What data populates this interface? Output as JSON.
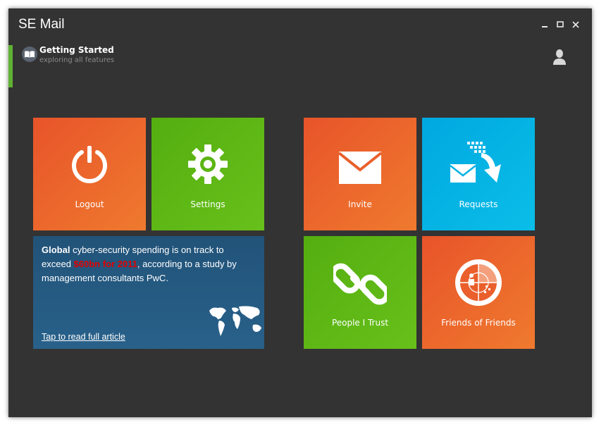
{
  "window": {
    "title": "SE Mail",
    "controls": {
      "minimize": "minimize-icon",
      "maximize": "maximize-icon",
      "close": "close-icon"
    }
  },
  "section": {
    "title": "Getting Started",
    "subtitle": "exploring all features",
    "icon": "book-icon"
  },
  "header": {
    "user_icon": "user-icon"
  },
  "tiles": {
    "logout": {
      "label": "Logout",
      "icon": "power-icon",
      "color": "#ea5f2b"
    },
    "settings": {
      "label": "Settings",
      "icon": "gear-icon",
      "color": "#5cb514"
    },
    "invite": {
      "label": "Invite",
      "icon": "envelope-icon",
      "color": "#ea5f2b"
    },
    "requests": {
      "label": "Requests",
      "icon": "incoming-mail-icon",
      "color": "#05b2e3"
    },
    "people_trust": {
      "label": "People I Trust",
      "icon": "link-chain-icon",
      "color": "#5cb514"
    },
    "friends_of_friends": {
      "label": "Friends of Friends",
      "icon": "network-radar-icon",
      "color": "#ea5f2b"
    }
  },
  "news": {
    "lead_bold": "Global",
    "text_1": " cyber-security spending is on track to exceed ",
    "highlight": "$60bn for 2011",
    "text_2": ", according to a study by management consultants PwC.",
    "link": "Tap to read full article",
    "highlight_color": "#e00000",
    "map_icon": "world-map-icon"
  },
  "colors": {
    "background": "#333333",
    "accent": "#5fb233",
    "orange": "#ea5f2b",
    "green": "#5cb514",
    "blue": "#05b2e3",
    "news": "#245a82"
  }
}
